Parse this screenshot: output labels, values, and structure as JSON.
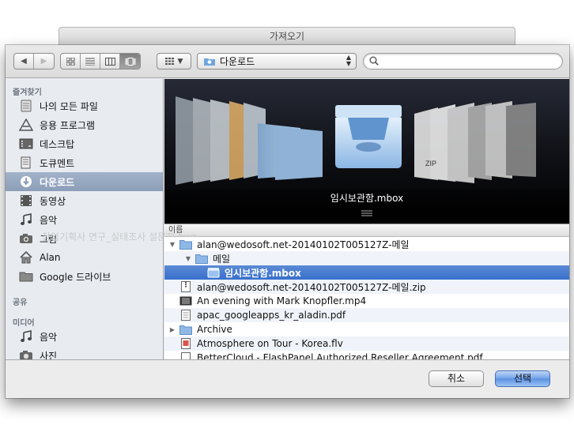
{
  "window": {
    "title": "가져오기"
  },
  "toolbar": {
    "back_icon": "arrow-left-icon",
    "forward_icon": "arrow-right-icon",
    "view_modes": [
      "icon-view",
      "list-view",
      "column-view",
      "coverflow-view"
    ],
    "active_view": "coverflow-view",
    "arrange_icon": "arrange-grid-icon",
    "location": "다운로드",
    "search_placeholder": ""
  },
  "sidebar": {
    "sections": [
      {
        "title": "즐겨찾기",
        "items": [
          {
            "label": "나의 모든 파일",
            "icon": "all-files-icon"
          },
          {
            "label": "응용 프로그램",
            "icon": "applications-icon"
          },
          {
            "label": "데스크탑",
            "icon": "desktop-icon"
          },
          {
            "label": "도큐멘트",
            "icon": "documents-icon"
          },
          {
            "label": "다운로드",
            "icon": "downloads-icon",
            "selected": true
          },
          {
            "label": "동영상",
            "icon": "movies-icon"
          },
          {
            "label": "음악",
            "icon": "music-icon"
          },
          {
            "label": "그림",
            "icon": "pictures-icon"
          },
          {
            "label": "Alan",
            "icon": "home-icon"
          },
          {
            "label": "Google 드라이브",
            "icon": "folder-icon"
          }
        ]
      },
      {
        "title": "공유",
        "items": []
      },
      {
        "title": "미디어",
        "items": [
          {
            "label": "음악",
            "icon": "music-icon"
          },
          {
            "label": "사진",
            "icon": "camera-icon"
          }
        ]
      }
    ]
  },
  "coverflow": {
    "selected_title": "임시보관함.mbox"
  },
  "file_list": {
    "column_name": "이름",
    "ghost_row": "창업기획사 연구_실태조사 설문지.hwp",
    "rows": [
      {
        "name": "alan@wedosoft.net-20140102T005127Z-메일",
        "depth": 0,
        "disclosure": "expanded",
        "icon": "folder-icon"
      },
      {
        "name": "메일",
        "depth": 1,
        "disclosure": "expanded",
        "icon": "folder-icon"
      },
      {
        "name": "임시보관함.mbox",
        "depth": 2,
        "disclosure": "none",
        "icon": "mbox-icon",
        "selected": true
      },
      {
        "name": "alan@wedosoft.net-20140102T005127Z-메일.zip",
        "depth": 0,
        "disclosure": "none",
        "icon": "zip-icon"
      },
      {
        "name": "An evening with Mark Knopfler.mp4",
        "depth": 0,
        "disclosure": "none",
        "icon": "video-icon"
      },
      {
        "name": "apac_googleapps_kr_aladin.pdf",
        "depth": 0,
        "disclosure": "none",
        "icon": "pdf-icon"
      },
      {
        "name": "Archive",
        "depth": 0,
        "disclosure": "collapsed",
        "icon": "folder-icon"
      },
      {
        "name": "Atmosphere on Tour - Korea.flv",
        "depth": 0,
        "disclosure": "none",
        "icon": "flv-icon"
      },
      {
        "name": "BetterCloud - FlashPanel Authorized Reseller Agreement.pdf",
        "depth": 0,
        "disclosure": "none",
        "icon": "pdf-icon"
      }
    ]
  },
  "buttons": {
    "cancel": "취소",
    "choose": "선택"
  },
  "colors": {
    "selection": "#3870cc",
    "sidebar_bg": "#e8ecf1",
    "coverflow_bg": "#0f1015"
  }
}
